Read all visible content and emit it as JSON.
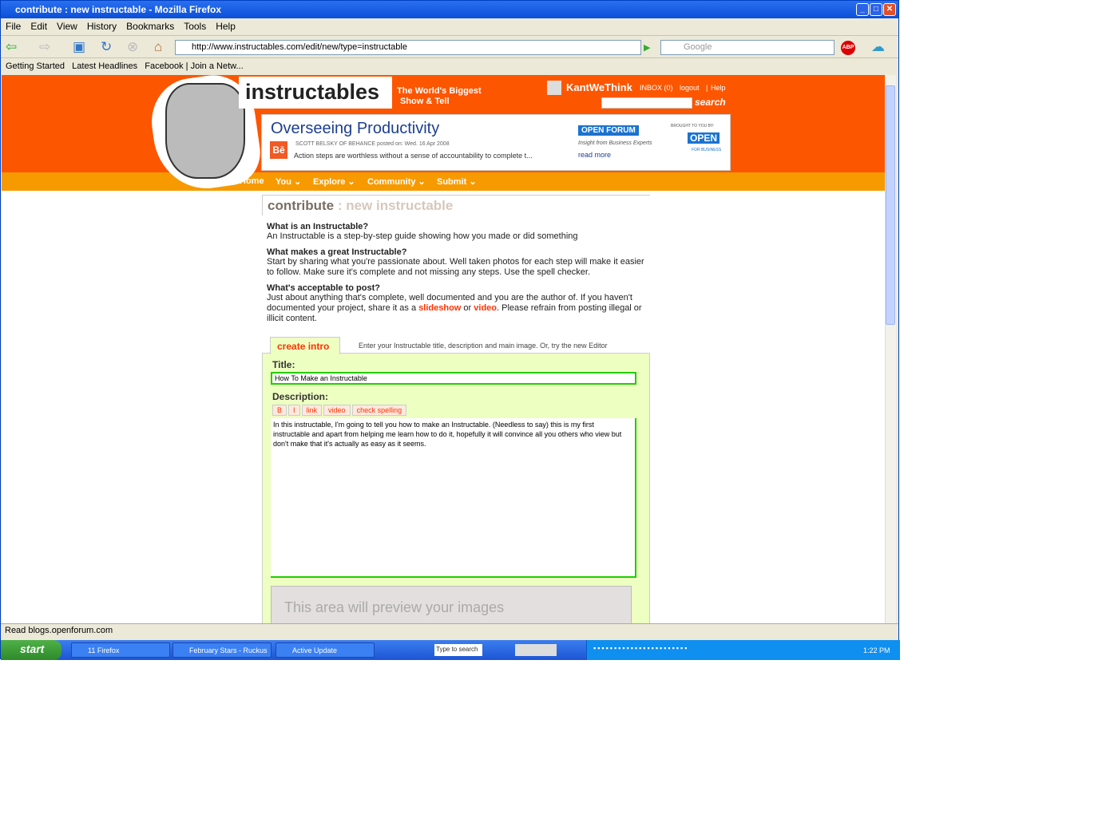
{
  "window": {
    "title": "contribute : new instructable - Mozilla Firefox"
  },
  "menu": [
    "File",
    "Edit",
    "View",
    "History",
    "Bookmarks",
    "Tools",
    "Help"
  ],
  "toolbar": {
    "url": "http://www.instructables.com/edit/new/type=instructable",
    "search_placeholder": "Google"
  },
  "bookmarks": [
    "Getting Started",
    "Latest Headlines",
    "Facebook",
    "Join a Netw..."
  ],
  "header": {
    "logo": "instructables",
    "tagline1": "The World's Biggest",
    "tagline2": "Show & Tell",
    "user": "KantWeThink",
    "inbox": "INBOX (0)",
    "logout": "logout",
    "help": "Help",
    "search_label": "search"
  },
  "ad": {
    "title": "Overseeing Productivity",
    "byline": "SCOTT BELSKY OF BEHANCE posted on: Wed. 16 Apr 2008",
    "text": "Action steps are worthless without a sense of accountability to complete t...",
    "badge": "Bē",
    "forum": "OPEN FORUM",
    "insight": "Insight from Business Experts",
    "read_more": "read more",
    "brought": "BROUGHT TO YOU BY:",
    "open": "OPEN",
    "open_sub": "FOR BUSINESS"
  },
  "nav": [
    "Home",
    "You ⌄",
    "Explore ⌄",
    "Community ⌄",
    "Submit ⌄"
  ],
  "content": {
    "heading1": "contribute",
    "heading2": " : new instructable",
    "q1": "What is an Instructable?",
    "a1": "An Instructable is a step-by-step guide showing how you made or did something",
    "q2": "What makes a great Instructable?",
    "a2": "Start by sharing what you're passionate about. Well taken photos for each step will make it easier to follow. Make sure it's complete and not missing any steps. Use the spell checker.",
    "q3": "What's acceptable to post?",
    "a3a": "Just about anything that's complete, well documented and you are the author of. If you haven't documented your project, share it as a ",
    "slideshow": "slideshow",
    "or": " or ",
    "video": "video",
    "a3b": ". Please refrain from posting illegal or illicit content."
  },
  "form": {
    "tab": "create intro",
    "tab_hint": "Enter your Instructable title, description and main image. Or, try the new Editor",
    "title_label": "Title:",
    "title_value": "How To Make an Instructable",
    "desc_label": "Description:",
    "buttons": [
      "B",
      "I",
      "link",
      "video",
      "check spelling"
    ],
    "desc_value": "In this instructable, I'm going to tell you how to make an Instructable.  (Needless to say) this is my first instructable and apart from helping me learn how to do it, hopefully it will convince all you others who view but don't make that it's actually as easy as it seems.",
    "preview": "This area will preview your images"
  },
  "status": "Read blogs.openforum.com",
  "taskbar": {
    "start": "start",
    "tasks": [
      "11 Firefox",
      "February Stars - Ruckus",
      "Active Update"
    ],
    "search": "Type to search",
    "clock": "1:22 PM"
  },
  "colors": {
    "header": "#fd5600",
    "nav": "#f79a00",
    "form_bg": "#eeffc2",
    "accent": "#ff3300"
  }
}
